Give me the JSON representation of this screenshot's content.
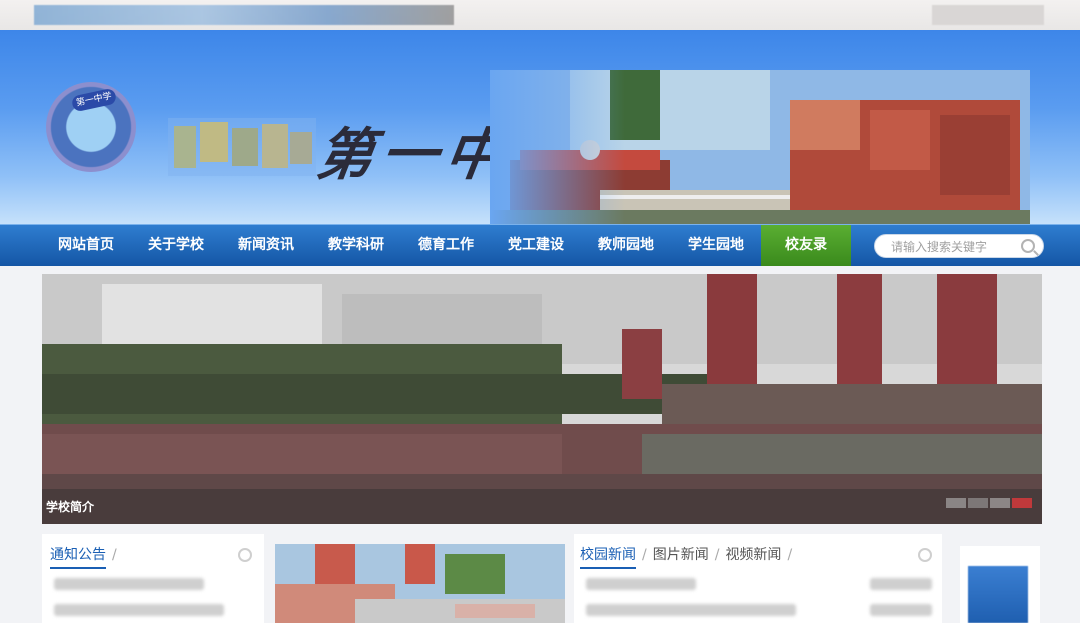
{
  "nav": {
    "items": [
      {
        "label": "网站首页"
      },
      {
        "label": "关于学校"
      },
      {
        "label": "新闻资讯"
      },
      {
        "label": "教学科研"
      },
      {
        "label": "德育工作"
      },
      {
        "label": "党工建设"
      },
      {
        "label": "教师园地"
      },
      {
        "label": "学生园地"
      },
      {
        "label": "校友录"
      }
    ],
    "active_index": 8
  },
  "search": {
    "placeholder": "请输入搜索关键字"
  },
  "header": {
    "school_title": "第一中学",
    "emblem_text": "第一中学"
  },
  "hero": {
    "caption": "学校简介"
  },
  "notice": {
    "tabs": [
      {
        "label": "通知公告"
      }
    ]
  },
  "news": {
    "tabs": [
      {
        "label": "校园新闻"
      },
      {
        "label": "图片新闻"
      },
      {
        "label": "视频新闻"
      }
    ]
  },
  "colors": {
    "nav_blue": "#1a64b9",
    "active_green": "#4a9a27",
    "accent": "#1a5fb4"
  }
}
